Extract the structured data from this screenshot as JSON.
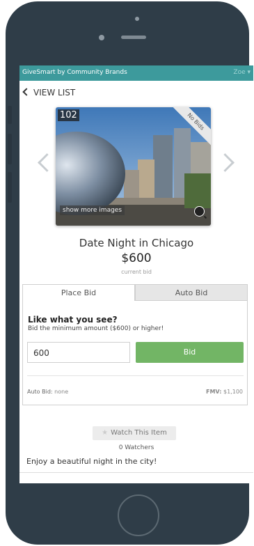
{
  "app": {
    "brand": "GiveSmart by Community Brands",
    "user": "Zoe ▾"
  },
  "nav": {
    "back_label": "VIEW LIST"
  },
  "item": {
    "lot_number": "102",
    "ribbon": "No Bids",
    "more_images": "show more images",
    "title": "Date Night in Chicago",
    "price": "$600",
    "price_caption": "current bid",
    "description": "Enjoy a beautiful night in the city!"
  },
  "tabs": {
    "place_bid": "Place Bid",
    "auto_bid": "Auto Bid",
    "active": "Place Bid"
  },
  "bid": {
    "headline": "Like what you see?",
    "instruction": "Bid the minimum amount ($600) or higher!",
    "input_value": "600",
    "button_label": "Bid",
    "auto_bid_label": "Auto Bid:",
    "auto_bid_value": "none",
    "fmv_label": "FMV:",
    "fmv_value": "$1,100"
  },
  "watch": {
    "button_label": "Watch This Item",
    "watchers": "0 Watchers"
  },
  "colors": {
    "topbar": "#3d9a9c",
    "bid_button": "#72b565",
    "phone_body": "#2f3d48"
  },
  "icons": {
    "back": "chevron-left-icon",
    "prev": "chevron-left-icon",
    "next": "chevron-right-icon",
    "zoom": "zoom-in-icon",
    "watch": "star-icon"
  }
}
